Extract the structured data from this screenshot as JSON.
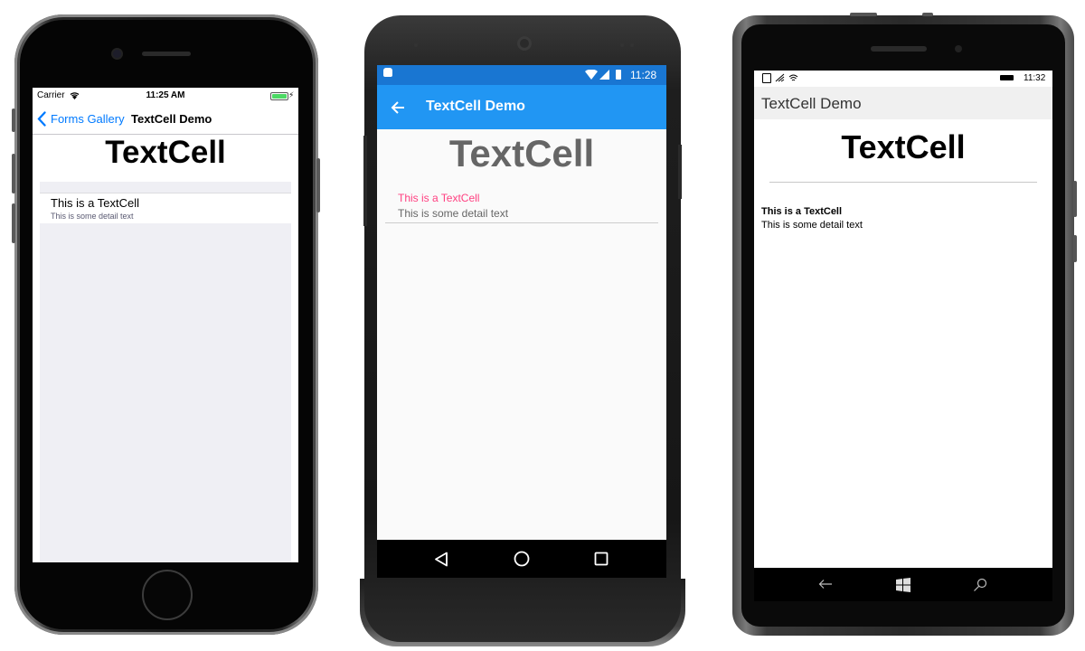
{
  "ios": {
    "carrier": "Carrier",
    "time": "11:25 AM",
    "back_label": "Forms Gallery",
    "nav_title": "TextCell Demo",
    "heading": "TextCell",
    "cell_text": "This is a TextCell",
    "cell_detail": "This is some detail text",
    "accent": "#007aff"
  },
  "android": {
    "time": "11:28",
    "app_title": "TextCell Demo",
    "heading": "TextCell",
    "cell_text": "This is a TextCell",
    "cell_detail": "This is some detail text",
    "primary_color": "#2196f3",
    "cell_text_color": "#ff4081"
  },
  "winphone": {
    "time": "11:32",
    "page_title": "TextCell Demo",
    "heading": "TextCell",
    "cell_text": "This is a TextCell",
    "cell_detail": "This is some detail text"
  }
}
